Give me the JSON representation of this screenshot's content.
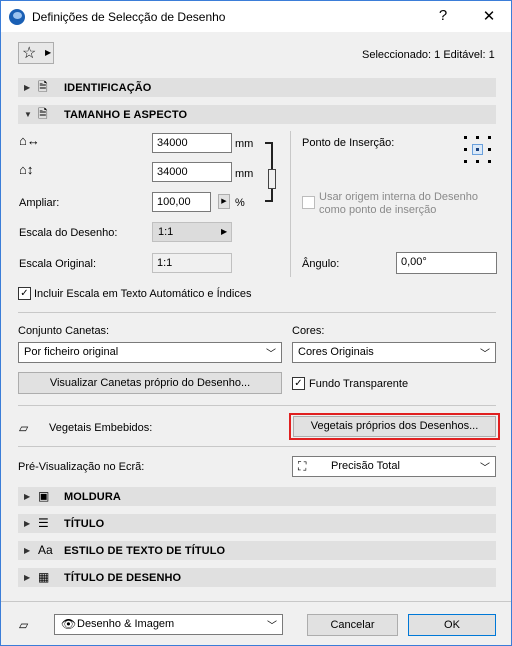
{
  "window": {
    "title": "Definições de Selecção de Desenho",
    "help": "?",
    "close": "✕"
  },
  "header": {
    "selected_text": "Seleccionado: 1 Editável: 1"
  },
  "sections": {
    "identification": "IDENTIFICAÇÃO",
    "size": "TAMANHO E ASPECTO",
    "frame": "MOLDURA",
    "title": "TÍTULO",
    "title_style": "ESTILO DE TEXTO DE TÍTULO",
    "drawing_title": "TÍTULO DE DESENHO"
  },
  "size": {
    "width_value": "34000",
    "height_value": "34000",
    "unit": "mm",
    "zoom_label": "Ampliar:",
    "zoom_value": "100,00",
    "zoom_unit": "%",
    "scale_label": "Escala do Desenho:",
    "scale_value": "1:1",
    "orig_scale_label": "Escala Original:",
    "orig_scale_value": "1:1",
    "anchor_label": "Ponto de Inserção:",
    "use_origin_label": "Usar origem interna do Desenho como ponto de inserção",
    "angle_label": "Ângulo:",
    "angle_value": "0,00°",
    "include_scale_label": "Incluir Escala em Texto Automático e Índices"
  },
  "pens": {
    "penset_label": "Conjunto Canetas:",
    "penset_value": "Por ficheiro original",
    "colors_label": "Cores:",
    "colors_value": "Cores Originais",
    "view_pens_button": "Visualizar Canetas próprio do Desenho...",
    "transparent_label": "Fundo Transparente"
  },
  "fills": {
    "label": "Vegetais Embebidos:",
    "button": "Vegetais próprios dos Desenhos..."
  },
  "preview": {
    "label": "Pré-Visualização no Ecrã:",
    "value": "Precisão Total"
  },
  "footer": {
    "layer_value": "Desenho & Imagem",
    "cancel": "Cancelar",
    "ok": "OK"
  },
  "colors": {
    "highlight": "#e02020",
    "accent": "#0078d7"
  }
}
